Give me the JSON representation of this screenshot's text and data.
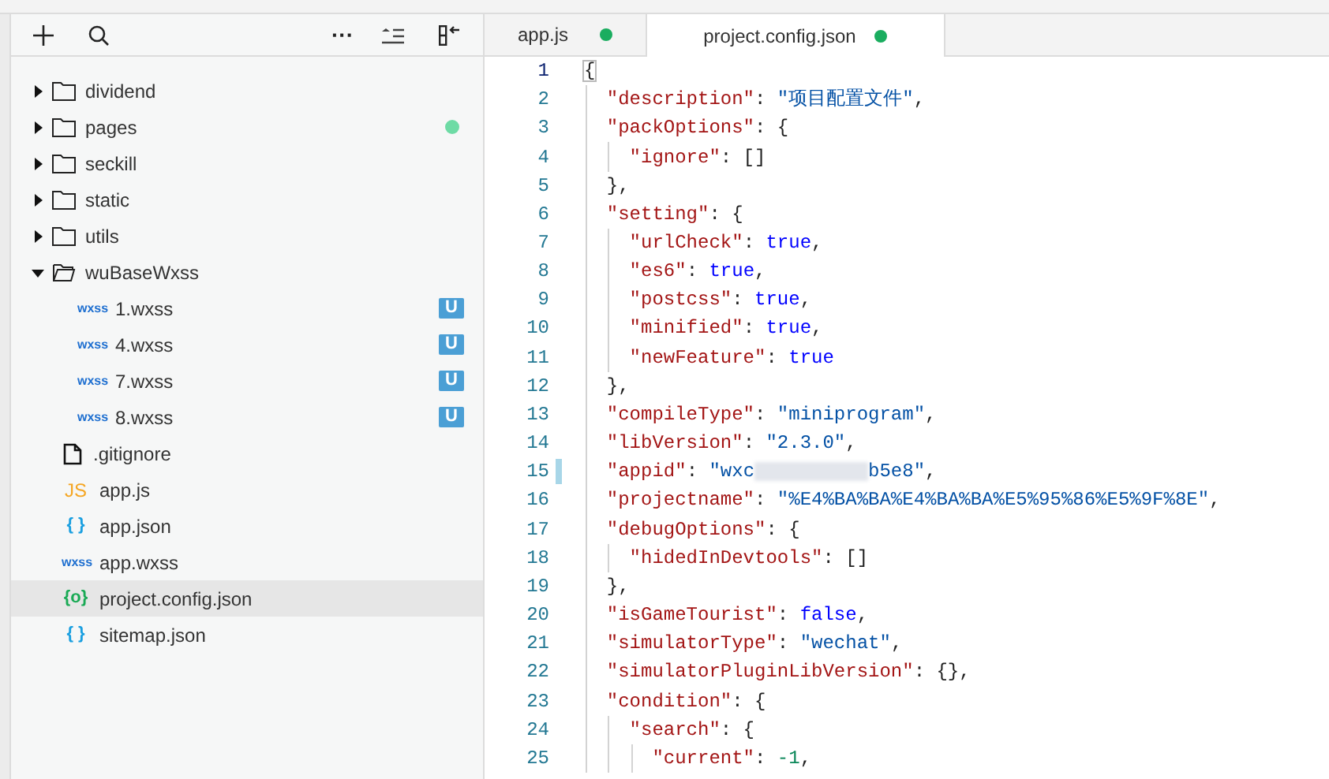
{
  "toolbar": {
    "more": "···"
  },
  "tree": [
    {
      "kind": "folder",
      "name": "dividend",
      "expanded": false,
      "modified": false,
      "selected": false
    },
    {
      "kind": "folder",
      "name": "pages",
      "expanded": false,
      "modified": true,
      "selected": false
    },
    {
      "kind": "folder",
      "name": "seckill",
      "expanded": false,
      "modified": false,
      "selected": false
    },
    {
      "kind": "folder",
      "name": "static",
      "expanded": false,
      "modified": false,
      "selected": false
    },
    {
      "kind": "folder",
      "name": "utils",
      "expanded": false,
      "modified": false,
      "selected": false
    },
    {
      "kind": "folder",
      "name": "wuBaseWxss",
      "expanded": true,
      "modified": false,
      "selected": false,
      "children": [
        {
          "kind": "wxss",
          "icon_label": "wxss",
          "name": "1.wxss",
          "badge": "U",
          "selected": false
        },
        {
          "kind": "wxss",
          "icon_label": "wxss",
          "name": "4.wxss",
          "badge": "U",
          "selected": false
        },
        {
          "kind": "wxss",
          "icon_label": "wxss",
          "name": "7.wxss",
          "badge": "U",
          "selected": false
        },
        {
          "kind": "wxss",
          "icon_label": "wxss",
          "name": "8.wxss",
          "badge": "U",
          "selected": false
        }
      ]
    },
    {
      "kind": "file",
      "name": ".gitignore",
      "selected": false
    },
    {
      "kind": "js",
      "icon_label": "JS",
      "name": "app.js",
      "selected": false
    },
    {
      "kind": "json",
      "icon_label": "{ }",
      "name": "app.json",
      "selected": false
    },
    {
      "kind": "wxss",
      "icon_label": "wxss",
      "name": "app.wxss",
      "selected": false
    },
    {
      "kind": "config",
      "icon_label": "{o}",
      "name": "project.config.json",
      "selected": true
    },
    {
      "kind": "json",
      "icon_label": "{ }",
      "name": "sitemap.json",
      "selected": false
    }
  ],
  "tabs": [
    {
      "label": "app.js",
      "modified": true,
      "selected": false
    },
    {
      "label": "project.config.json",
      "modified": true,
      "selected": true
    }
  ],
  "editor": {
    "lines": [
      {
        "number": "1",
        "current": true,
        "changed": false,
        "tokens": [
          {
            "kind": "bracket",
            "text": "{"
          }
        ],
        "children": [
          {
            "number": "2",
            "current": false,
            "changed": false,
            "tokens": [
              {
                "kind": "key",
                "text": "\"description\""
              },
              {
                "kind": "punct",
                "text": ": "
              },
              {
                "kind": "string",
                "text": "\"项目配置文件\""
              },
              {
                "kind": "punct",
                "text": ","
              }
            ]
          },
          {
            "number": "3",
            "current": false,
            "changed": false,
            "tokens": [
              {
                "kind": "key",
                "text": "\"packOptions\""
              },
              {
                "kind": "punct",
                "text": ": {"
              }
            ],
            "children": [
              {
                "number": "4",
                "current": false,
                "changed": false,
                "tokens": [
                  {
                    "kind": "key",
                    "text": "\"ignore\""
                  },
                  {
                    "kind": "punct",
                    "text": ": []"
                  }
                ]
              }
            ]
          },
          {
            "number": "5",
            "current": false,
            "changed": false,
            "tokens": [
              {
                "kind": "punct",
                "text": "},"
              }
            ]
          },
          {
            "number": "6",
            "current": false,
            "changed": false,
            "tokens": [
              {
                "kind": "key",
                "text": "\"setting\""
              },
              {
                "kind": "punct",
                "text": ": {"
              }
            ],
            "children": [
              {
                "number": "7",
                "current": false,
                "changed": false,
                "tokens": [
                  {
                    "kind": "key",
                    "text": "\"urlCheck\""
                  },
                  {
                    "kind": "punct",
                    "text": ": "
                  },
                  {
                    "kind": "literal",
                    "text": "true"
                  },
                  {
                    "kind": "punct",
                    "text": ","
                  }
                ]
              },
              {
                "number": "8",
                "current": false,
                "changed": false,
                "tokens": [
                  {
                    "kind": "key",
                    "text": "\"es6\""
                  },
                  {
                    "kind": "punct",
                    "text": ": "
                  },
                  {
                    "kind": "literal",
                    "text": "true"
                  },
                  {
                    "kind": "punct",
                    "text": ","
                  }
                ]
              },
              {
                "number": "9",
                "current": false,
                "changed": false,
                "tokens": [
                  {
                    "kind": "key",
                    "text": "\"postcss\""
                  },
                  {
                    "kind": "punct",
                    "text": ": "
                  },
                  {
                    "kind": "literal",
                    "text": "true"
                  },
                  {
                    "kind": "punct",
                    "text": ","
                  }
                ]
              },
              {
                "number": "10",
                "current": false,
                "changed": false,
                "tokens": [
                  {
                    "kind": "key",
                    "text": "\"minified\""
                  },
                  {
                    "kind": "punct",
                    "text": ": "
                  },
                  {
                    "kind": "literal",
                    "text": "true"
                  },
                  {
                    "kind": "punct",
                    "text": ","
                  }
                ]
              },
              {
                "number": "11",
                "current": false,
                "changed": false,
                "tokens": [
                  {
                    "kind": "key",
                    "text": "\"newFeature\""
                  },
                  {
                    "kind": "punct",
                    "text": ": "
                  },
                  {
                    "kind": "literal",
                    "text": "true"
                  }
                ]
              }
            ]
          },
          {
            "number": "12",
            "current": false,
            "changed": false,
            "tokens": [
              {
                "kind": "punct",
                "text": "},"
              }
            ]
          },
          {
            "number": "13",
            "current": false,
            "changed": false,
            "tokens": [
              {
                "kind": "key",
                "text": "\"compileType\""
              },
              {
                "kind": "punct",
                "text": ": "
              },
              {
                "kind": "string",
                "text": "\"miniprogram\""
              },
              {
                "kind": "punct",
                "text": ","
              }
            ]
          },
          {
            "number": "14",
            "current": false,
            "changed": false,
            "tokens": [
              {
                "kind": "key",
                "text": "\"libVersion\""
              },
              {
                "kind": "punct",
                "text": ": "
              },
              {
                "kind": "string",
                "text": "\"2.3.0\""
              },
              {
                "kind": "punct",
                "text": ","
              }
            ]
          },
          {
            "number": "15",
            "current": false,
            "changed": true,
            "tokens": [
              {
                "kind": "key",
                "text": "\"appid\""
              },
              {
                "kind": "punct",
                "text": ": "
              },
              {
                "kind": "string",
                "text": "\"wxc"
              },
              {
                "kind": "redacted"
              },
              {
                "kind": "string",
                "text": "b5e8\""
              },
              {
                "kind": "punct",
                "text": ","
              }
            ]
          },
          {
            "number": "16",
            "current": false,
            "changed": false,
            "tokens": [
              {
                "kind": "key",
                "text": "\"projectname\""
              },
              {
                "kind": "punct",
                "text": ": "
              },
              {
                "kind": "string",
                "text": "\"%E4%BA%BA%E4%BA%BA%E5%95%86%E5%9F%8E\""
              },
              {
                "kind": "punct",
                "text": ","
              }
            ]
          },
          {
            "number": "17",
            "current": false,
            "changed": false,
            "tokens": [
              {
                "kind": "key",
                "text": "\"debugOptions\""
              },
              {
                "kind": "punct",
                "text": ": {"
              }
            ],
            "children": [
              {
                "number": "18",
                "current": false,
                "changed": false,
                "tokens": [
                  {
                    "kind": "key",
                    "text": "\"hidedInDevtools\""
                  },
                  {
                    "kind": "punct",
                    "text": ": []"
                  }
                ]
              }
            ]
          },
          {
            "number": "19",
            "current": false,
            "changed": false,
            "tokens": [
              {
                "kind": "punct",
                "text": "},"
              }
            ]
          },
          {
            "number": "20",
            "current": false,
            "changed": false,
            "tokens": [
              {
                "kind": "key",
                "text": "\"isGameTourist\""
              },
              {
                "kind": "punct",
                "text": ": "
              },
              {
                "kind": "literal",
                "text": "false"
              },
              {
                "kind": "punct",
                "text": ","
              }
            ]
          },
          {
            "number": "21",
            "current": false,
            "changed": false,
            "tokens": [
              {
                "kind": "key",
                "text": "\"simulatorType\""
              },
              {
                "kind": "punct",
                "text": ": "
              },
              {
                "kind": "string",
                "text": "\"wechat\""
              },
              {
                "kind": "punct",
                "text": ","
              }
            ]
          },
          {
            "number": "22",
            "current": false,
            "changed": false,
            "tokens": [
              {
                "kind": "key",
                "text": "\"simulatorPluginLibVersion\""
              },
              {
                "kind": "punct",
                "text": ": {},"
              }
            ]
          },
          {
            "number": "23",
            "current": false,
            "changed": false,
            "tokens": [
              {
                "kind": "key",
                "text": "\"condition\""
              },
              {
                "kind": "punct",
                "text": ": {"
              }
            ],
            "children": [
              {
                "number": "24",
                "current": false,
                "changed": false,
                "tokens": [
                  {
                    "kind": "key",
                    "text": "\"search\""
                  },
                  {
                    "kind": "punct",
                    "text": ": {"
                  }
                ],
                "children": [
                  {
                    "number": "25",
                    "current": false,
                    "changed": false,
                    "tokens": [
                      {
                        "kind": "key",
                        "text": "\"current\""
                      },
                      {
                        "kind": "punct",
                        "text": ": "
                      },
                      {
                        "kind": "number",
                        "text": "-1"
                      },
                      {
                        "kind": "punct",
                        "text": ","
                      }
                    ]
                  }
                ]
              }
            ]
          }
        ]
      }
    ]
  }
}
